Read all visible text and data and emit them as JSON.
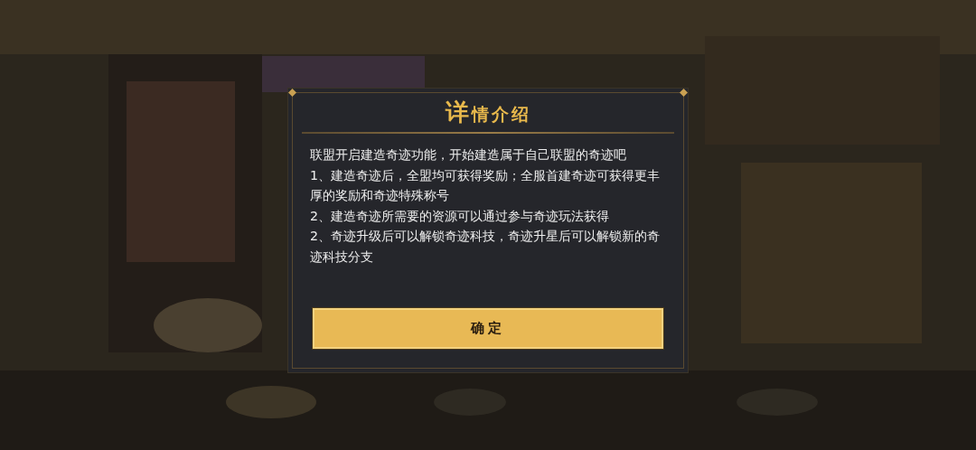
{
  "dialog": {
    "title": "详情介绍",
    "paragraphs": [
      "联盟开启建造奇迹功能，开始建造属于自己联盟的奇迹吧",
      "1、建造奇迹后，全盟均可获得奖励；全服首建奇迹可获得更丰厚的奖励和奇迹特殊称号",
      "2、建造奇迹所需要的资源可以通过参与奇迹玩法获得",
      "2、奇迹升级后可以解锁奇迹科技，奇迹升星后可以解锁新的奇迹科技分支"
    ],
    "confirm_button": "确定"
  }
}
